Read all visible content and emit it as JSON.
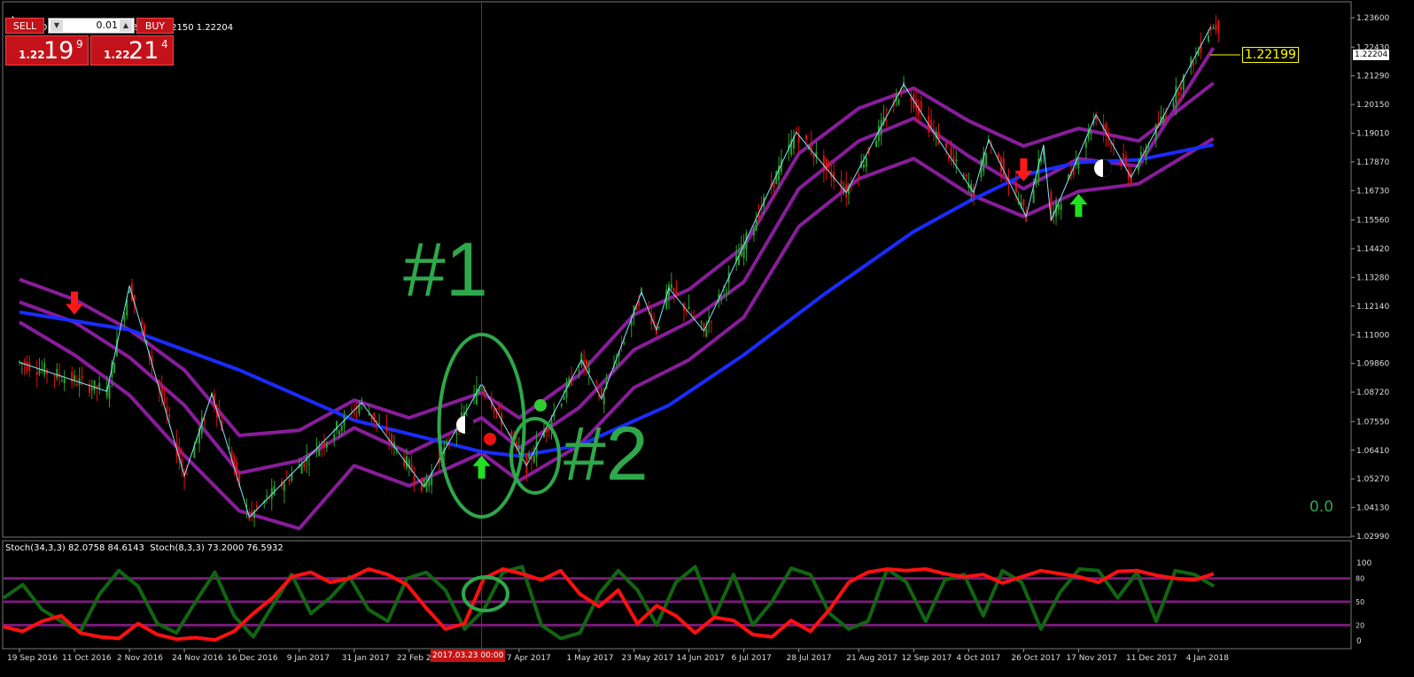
{
  "symbol_info": "EURUSD,Daily  1.22366 1.22954 1.22150 1.22204",
  "trade_panel": {
    "sell_label": "SELL",
    "buy_label": "BUY",
    "lot_value": "0.01",
    "sell_price": {
      "prefix": "1.22",
      "big": "19",
      "sup": "9"
    },
    "buy_price": {
      "prefix": "1.22",
      "big": "21",
      "sup": "4"
    }
  },
  "price_axis_ticks": [
    "1.23600",
    "1.22430",
    "1.21290",
    "1.20150",
    "1.19010",
    "1.17870",
    "1.16730",
    "1.15560",
    "1.14420",
    "1.13280",
    "1.12140",
    "1.11000",
    "1.09860",
    "1.08720",
    "1.07550",
    "1.06410",
    "1.05270",
    "1.04130",
    "1.02990"
  ],
  "current_price_label": "1.22204",
  "line_price_label": "1.22199",
  "annotations": {
    "label1": "#1",
    "label2": "#2",
    "zero_label": "0.0"
  },
  "indicator_info": "Stoch(34,3,3) 82.0758 84.6143  Stoch(8,3,3) 73.2000 76.5932",
  "indicator_axis_ticks": [
    "100",
    "0"
  ],
  "indicator_level_labels": [
    "80",
    "50",
    "20"
  ],
  "date_axis_ticks": [
    "19 Sep 2016",
    "11 Oct 2016",
    "2 Nov 2016",
    "24 Nov 2016",
    "16 Dec 2016",
    "9 Jan 2017",
    "31 Jan 2017",
    "22 Feb 2017",
    "7 Apr 2017",
    "1 May 2017",
    "23 May 2017",
    "14 Jun 2017",
    "6 Jul 2017",
    "28 Jul 2017",
    "21 Aug 2017",
    "12 Sep 2017",
    "4 Oct 2017",
    "26 Oct 2017",
    "17 Nov 2017",
    "11 Dec 2017",
    "4 Jan 2018"
  ],
  "crosshair_date_label": "2017.03.23 00:00",
  "colors": {
    "background": "#000000",
    "bull_candle": "#2aa02a",
    "bear_candle": "#e01010",
    "zigzag": "#7de8ff",
    "moving_average": "#1a2cff",
    "envelope": "#8a1c9c",
    "annotation_green": "#2ea84a",
    "arrow_up": "#20e020",
    "arrow_down": "#ff1818",
    "stoch_slow": "#ff1010",
    "stoch_fast": "#116611",
    "levels": "#7a1a7a",
    "crosshair": "#c41414",
    "price_label": "#ffff00"
  },
  "chart_data": {
    "type": "candlestick",
    "symbol": "EURUSD",
    "timeframe": "Daily",
    "ohlc_last": {
      "open": 1.22366,
      "high": 1.22954,
      "low": 1.2215,
      "close": 1.22204
    },
    "ylim": [
      1.0299,
      1.236
    ],
    "zigzag_pivots": [
      {
        "date": "19 Sep 2016",
        "price": 1.099
      },
      {
        "date": "24 Oct 2016",
        "price": 1.0875
      },
      {
        "date": "2 Nov 2016",
        "price": 1.1295
      },
      {
        "date": "24 Nov 2016",
        "price": 1.054
      },
      {
        "date": "5 Dec 2016",
        "price": 1.0865
      },
      {
        "date": "20 Dec 2016",
        "price": 1.0375
      },
      {
        "date": "3 Feb 2017",
        "price": 1.083
      },
      {
        "date": "28 Feb 2017",
        "price": 1.0495
      },
      {
        "date": "23 Mar 2017",
        "price": 1.0905
      },
      {
        "date": "10 Apr 2017",
        "price": 1.058
      },
      {
        "date": "2 May 2017",
        "price": 1.1
      },
      {
        "date": "10 May 2017",
        "price": 1.0845
      },
      {
        "date": "26 May 2017",
        "price": 1.127
      },
      {
        "date": "1 Jun 2017",
        "price": 1.112
      },
      {
        "date": "6 Jun 2017",
        "price": 1.1285
      },
      {
        "date": "20 Jun 2017",
        "price": 1.1115
      },
      {
        "date": "27 Jul 2017",
        "price": 1.1905
      },
      {
        "date": "16 Aug 2017",
        "price": 1.1665
      },
      {
        "date": "8 Sep 2017",
        "price": 1.2095
      },
      {
        "date": "18 Sep 2017",
        "price": 1.1935
      },
      {
        "date": "6 Oct 2017",
        "price": 1.1665
      },
      {
        "date": "12 Oct 2017",
        "price": 1.1875
      },
      {
        "date": "27 Oct 2017",
        "price": 1.157
      },
      {
        "date": "3 Nov 2017",
        "price": 1.1855
      },
      {
        "date": "6 Nov 2017",
        "price": 1.1555
      },
      {
        "date": "24 Nov 2017",
        "price": 1.1975
      },
      {
        "date": "8 Dec 2017",
        "price": 1.1725
      },
      {
        "date": "9 Jan 2018",
        "price": 1.2325
      }
    ],
    "moving_average": [
      {
        "date": "19 Sep 2016",
        "value": 1.119
      },
      {
        "date": "2 Nov 2016",
        "value": 1.112
      },
      {
        "date": "16 Dec 2016",
        "value": 1.096
      },
      {
        "date": "31 Jan 2017",
        "value": 1.076
      },
      {
        "date": "23 Mar 2017",
        "value": 1.0635
      },
      {
        "date": "7 Apr 2017",
        "value": 1.0618
      },
      {
        "date": "1 May 2017",
        "value": 1.066
      },
      {
        "date": "6 Jun 2017",
        "value": 1.082
      },
      {
        "date": "6 Jul 2017",
        "value": 1.102
      },
      {
        "date": "7 Aug 2017",
        "value": 1.126
      },
      {
        "date": "12 Sep 2017",
        "value": 1.151
      },
      {
        "date": "4 Oct 2017",
        "value": 1.163
      },
      {
        "date": "26 Oct 2017",
        "value": 1.1735
      },
      {
        "date": "17 Nov 2017",
        "value": 1.1785
      },
      {
        "date": "11 Dec 2017",
        "value": 1.1795
      },
      {
        "date": "10 Jan 2018",
        "value": 1.1855
      }
    ],
    "envelope_upper": [
      {
        "date": "19 Sep 2016",
        "value": 1.132
      },
      {
        "date": "11 Oct 2016",
        "value": 1.124
      },
      {
        "date": "2 Nov 2016",
        "value": 1.112
      },
      {
        "date": "24 Nov 2016",
        "value": 1.096
      },
      {
        "date": "16 Dec 2016",
        "value": 1.07
      },
      {
        "date": "9 Jan 2017",
        "value": 1.072
      },
      {
        "date": "31 Jan 2017",
        "value": 1.084
      },
      {
        "date": "22 Feb 2017",
        "value": 1.077
      },
      {
        "date": "23 Mar 2017",
        "value": 1.087
      },
      {
        "date": "7 Apr 2017",
        "value": 1.077
      },
      {
        "date": "1 May 2017",
        "value": 1.094
      },
      {
        "date": "23 May 2017",
        "value": 1.118
      },
      {
        "date": "14 Jun 2017",
        "value": 1.128
      },
      {
        "date": "6 Jul 2017",
        "value": 1.145
      },
      {
        "date": "28 Jul 2017",
        "value": 1.182
      },
      {
        "date": "21 Aug 2017",
        "value": 1.2
      },
      {
        "date": "12 Sep 2017",
        "value": 1.208
      },
      {
        "date": "4 Oct 2017",
        "value": 1.195
      },
      {
        "date": "26 Oct 2017",
        "value": 1.185
      },
      {
        "date": "17 Nov 2017",
        "value": 1.192
      },
      {
        "date": "11 Dec 2017",
        "value": 1.187
      },
      {
        "date": "10 Jan 2018",
        "value": 1.21
      }
    ],
    "envelope_mid": [
      {
        "date": "19 Sep 2016",
        "value": 1.123
      },
      {
        "date": "11 Oct 2016",
        "value": 1.115
      },
      {
        "date": "2 Nov 2016",
        "value": 1.101
      },
      {
        "date": "24 Nov 2016",
        "value": 1.082
      },
      {
        "date": "16 Dec 2016",
        "value": 1.055
      },
      {
        "date": "9 Jan 2017",
        "value": 1.06
      },
      {
        "date": "31 Jan 2017",
        "value": 1.073
      },
      {
        "date": "22 Feb 2017",
        "value": 1.063
      },
      {
        "date": "23 Mar 2017",
        "value": 1.077
      },
      {
        "date": "7 Apr 2017",
        "value": 1.065
      },
      {
        "date": "1 May 2017",
        "value": 1.081
      },
      {
        "date": "23 May 2017",
        "value": 1.104
      },
      {
        "date": "14 Jun 2017",
        "value": 1.115
      },
      {
        "date": "6 Jul 2017",
        "value": 1.131
      },
      {
        "date": "28 Jul 2017",
        "value": 1.168
      },
      {
        "date": "21 Aug 2017",
        "value": 1.187
      },
      {
        "date": "12 Sep 2017",
        "value": 1.196
      },
      {
        "date": "4 Oct 2017",
        "value": 1.181
      },
      {
        "date": "26 Oct 2017",
        "value": 1.168
      },
      {
        "date": "17 Nov 2017",
        "value": 1.18
      },
      {
        "date": "11 Dec 2017",
        "value": 1.177
      },
      {
        "date": "10 Jan 2018",
        "value": 1.224
      }
    ],
    "envelope_lower": [
      {
        "date": "19 Sep 2016",
        "value": 1.115
      },
      {
        "date": "11 Oct 2016",
        "value": 1.102
      },
      {
        "date": "2 Nov 2016",
        "value": 1.086
      },
      {
        "date": "24 Nov 2016",
        "value": 1.062
      },
      {
        "date": "16 Dec 2016",
        "value": 1.04
      },
      {
        "date": "9 Jan 2017",
        "value": 1.033
      },
      {
        "date": "31 Jan 2017",
        "value": 1.058
      },
      {
        "date": "22 Feb 2017",
        "value": 1.05
      },
      {
        "date": "23 Mar 2017",
        "value": 1.063
      },
      {
        "date": "7 Apr 2017",
        "value": 1.052
      },
      {
        "date": "1 May 2017",
        "value": 1.066
      },
      {
        "date": "23 May 2017",
        "value": 1.089
      },
      {
        "date": "14 Jun 2017",
        "value": 1.1
      },
      {
        "date": "6 Jul 2017",
        "value": 1.117
      },
      {
        "date": "28 Jul 2017",
        "value": 1.153
      },
      {
        "date": "21 Aug 2017",
        "value": 1.172
      },
      {
        "date": "12 Sep 2017",
        "value": 1.18
      },
      {
        "date": "4 Oct 2017",
        "value": 1.166
      },
      {
        "date": "26 Oct 2017",
        "value": 1.157
      },
      {
        "date": "17 Nov 2017",
        "value": 1.167
      },
      {
        "date": "11 Dec 2017",
        "value": 1.17
      },
      {
        "date": "10 Jan 2018",
        "value": 1.188
      }
    ],
    "stochastic": {
      "levels": [
        80,
        50,
        20
      ],
      "slow_34_3_3": [
        18,
        12,
        25,
        32,
        10,
        5,
        3,
        22,
        8,
        2,
        4,
        1,
        12,
        35,
        55,
        82,
        88,
        75,
        80,
        92,
        85,
        72,
        42,
        15,
        22,
        80,
        92,
        86,
        78,
        90,
        60,
        44,
        65,
        22,
        45,
        32,
        10,
        30,
        26,
        8,
        5,
        26,
        12,
        40,
        75,
        88,
        92,
        90,
        92,
        86,
        82,
        85,
        74,
        82,
        90,
        86,
        82,
        75,
        89,
        90,
        84,
        80,
        78,
        86
      ],
      "fast_8_3_3": [
        55,
        72,
        40,
        25,
        12,
        60,
        90,
        70,
        22,
        10,
        50,
        88,
        32,
        5,
        45,
        85,
        35,
        55,
        82,
        40,
        25,
        80,
        88,
        65,
        15,
        40,
        88,
        95,
        20,
        3,
        10,
        60,
        90,
        65,
        20,
        75,
        95,
        30,
        85,
        20,
        50,
        93,
        85,
        35,
        15,
        25,
        92,
        75,
        25,
        78,
        85,
        32,
        90,
        75,
        15,
        62,
        92,
        90,
        55,
        88,
        25,
        90,
        85,
        70
      ]
    },
    "arrows": [
      {
        "dir": "down",
        "date": "11 Oct 2016",
        "price": 1.118
      },
      {
        "dir": "up",
        "date": "23 Mar 2017",
        "price": 1.062
      },
      {
        "dir": "down",
        "date": "26 Oct 2017",
        "price": 1.171
      },
      {
        "dir": "up",
        "date": "17 Nov 2017",
        "price": 1.166
      }
    ]
  }
}
